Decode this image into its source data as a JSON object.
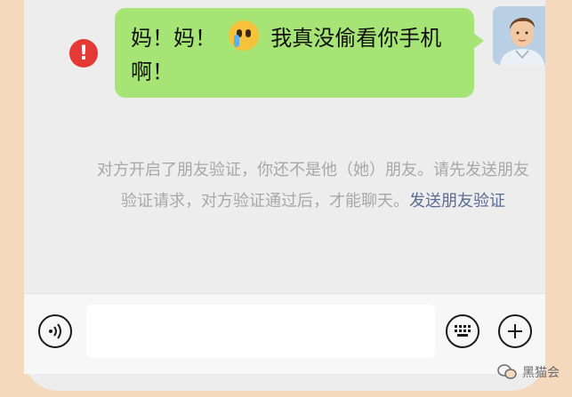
{
  "message": {
    "text_part1": "妈！妈！",
    "text_part2": "我真没偷看你手机",
    "text_part3": "啊！",
    "emoji": "crying-face-emoji"
  },
  "notice": {
    "text": "对方开启了朋友验证，你还不是他（她）朋友。请先发送朋友验证请求，对方验证通过后，才能聊天。",
    "link": "发送朋友验证"
  },
  "input": {
    "placeholder": ""
  },
  "watermark": {
    "label": "黑猫会"
  },
  "colors": {
    "bubble": "#a6e476",
    "error": "#e53935",
    "link": "#5b6b93",
    "background": "#f5d9bd"
  },
  "icons": [
    "error-icon",
    "voice-icon",
    "keyboard-icon",
    "plus-icon",
    "wechat-icon"
  ]
}
